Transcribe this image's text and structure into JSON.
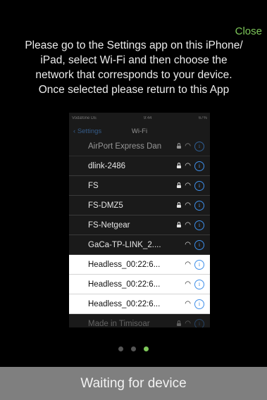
{
  "close_label": "Close",
  "instructions": [
    "Please go to the Settings app on this iPhone/",
    "iPad, select Wi-Fi and then choose the",
    "network that corresponds to your device.",
    "Once selected please return to this App"
  ],
  "screenshot": {
    "carrier": "Vodafone DE",
    "time": "9:44",
    "battery": "67%",
    "back_label": "Settings",
    "nav_title": "Wi-Fi",
    "networks": [
      {
        "name": "AirPort Express Dan",
        "lock": true
      },
      {
        "name": "dlink-2486",
        "lock": true
      },
      {
        "name": "FS",
        "lock": true
      },
      {
        "name": "FS-DMZ5",
        "lock": true
      },
      {
        "name": "FS-Netgear",
        "lock": true
      },
      {
        "name": "GaCa-TP-LINK_2....",
        "lock": false
      },
      {
        "name": "Headless_00:22:6...",
        "lock": false
      },
      {
        "name": "Headless_00:22:6...",
        "lock": false
      },
      {
        "name": "Headless_00:22:6...",
        "lock": false
      },
      {
        "name": "Made in Timisoar",
        "lock": true
      }
    ],
    "wifi_icon": "wifi-icon",
    "info_icon": "info-icon",
    "lock_icon": "lock-icon"
  },
  "pagination": {
    "pages": 3,
    "current": 3
  },
  "status_text": "Waiting for device",
  "colors": {
    "accent": "#7ec85a",
    "bar": "#7f7f7f",
    "link": "#3e8ee8"
  }
}
